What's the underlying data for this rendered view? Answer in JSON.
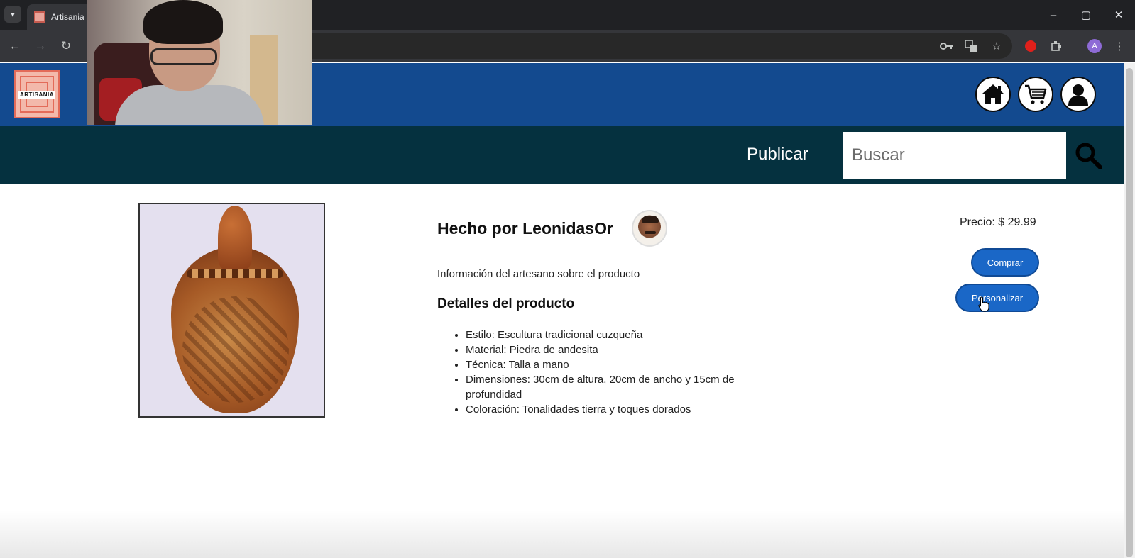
{
  "browser": {
    "tab_list_icon": "chevron-down-icon",
    "tab_title": "Artisania",
    "window_controls": [
      "–",
      "▢",
      "✕"
    ]
  },
  "site": {
    "logo_text": "ARTISANIA",
    "header_icons": [
      "home-icon",
      "cart-icon",
      "user-icon"
    ],
    "nav": {
      "publish_label": "Publicar",
      "search_placeholder": "Buscar"
    }
  },
  "product": {
    "maker_title": "Hecho por LeonidasOr",
    "info_text": "Información del artesano sobre el producto",
    "details_title": "Detalles del producto",
    "details": [
      "Estilo: Escultura tradicional cuzqueña",
      "Material: Piedra de andesita",
      "Técnica: Talla a mano",
      "Dimensiones: 30cm de altura, 20cm de ancho y 15cm de profundidad",
      "Coloración: Tonalidades tierra y toques dorados"
    ],
    "price": "Precio: $ 29.99",
    "buy_label": "Comprar",
    "customize_label": "Personalizar"
  },
  "colors": {
    "header_blue": "#134a8f",
    "nav_dark": "#05313f",
    "button_blue": "#1a67c7"
  }
}
